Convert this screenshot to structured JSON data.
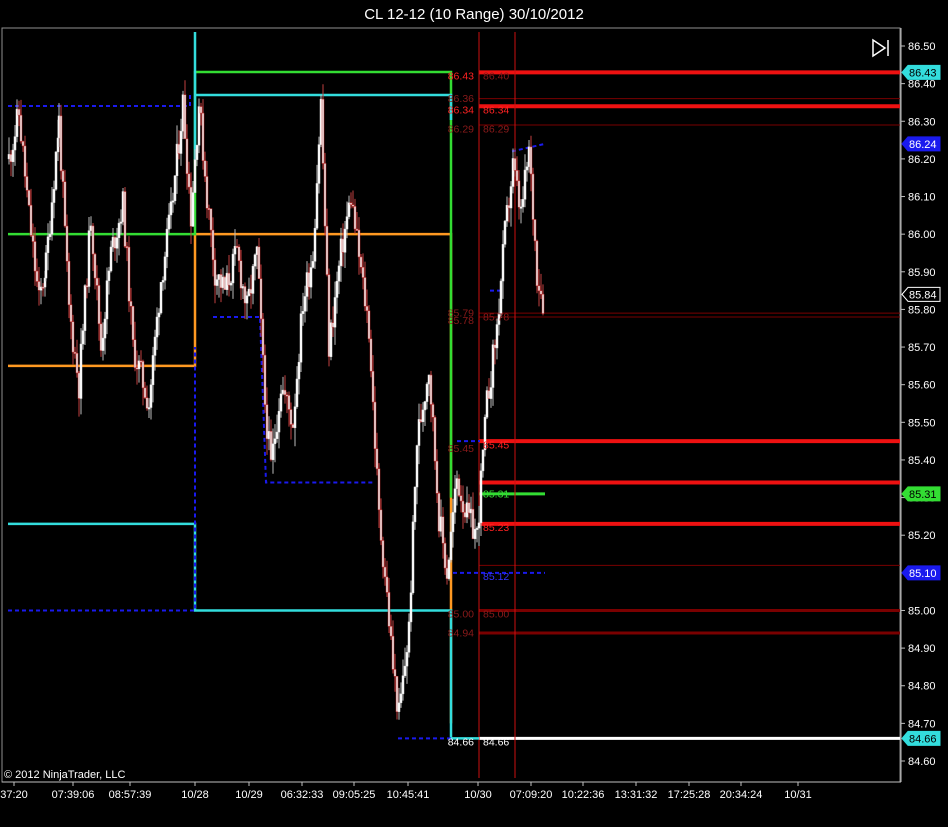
{
  "window": {
    "title": "CL 12-12 (10 Range)  30/10/2012"
  },
  "copyright": "© 2012 NinjaTrader, LLC",
  "colors": {
    "background": "#000000",
    "axis": "#c0c0c0",
    "green": "#33dd33",
    "cyan": "#33dddd",
    "orange": "#ff9922",
    "red": "#ee1111",
    "dark_red": "#7a0000",
    "blue_dashed": "#1a1aee",
    "white": "#ffffff"
  },
  "icons": {
    "scroll_end": "play-to-end-icon"
  },
  "chart_data": {
    "type": "candlestick",
    "y_axis": {
      "min": 84.56,
      "max": 86.54,
      "ticks": [
        "86.50",
        "86.40",
        "86.30",
        "86.20",
        "86.10",
        "86.00",
        "85.90",
        "85.80",
        "85.70",
        "85.60",
        "85.50",
        "85.40",
        "85.30",
        "85.20",
        "85.10",
        "85.00",
        "84.90",
        "84.80",
        "84.70",
        "84.60"
      ]
    },
    "x_axis": {
      "ticks": [
        "37:20",
        "07:39:06",
        "08:57:39",
        "10/28",
        "10/29",
        "06:32:33",
        "09:05:25",
        "10:45:41",
        "10/30",
        "07:09:20",
        "10:22:36",
        "13:31:32",
        "17:25:28",
        "20:34:24",
        "10/31"
      ]
    },
    "price_markers": [
      {
        "label": "86.43",
        "value": 86.43,
        "style": "cyan"
      },
      {
        "label": "86.24",
        "value": 86.24,
        "style": "blue"
      },
      {
        "label": "85.84",
        "value": 85.84,
        "style": "dark"
      },
      {
        "label": "85.31",
        "value": 85.31,
        "style": "green"
      },
      {
        "label": "85.10",
        "value": 85.1,
        "style": "blue"
      },
      {
        "label": "84.66",
        "value": 84.66,
        "style": "cyan"
      }
    ],
    "level_labels_right": [
      {
        "label": "86.40",
        "value": 86.42,
        "style": "dark"
      },
      {
        "label": "86.34",
        "value": 86.33,
        "style": "red"
      },
      {
        "label": "86.29",
        "value": 86.28,
        "style": "dark"
      },
      {
        "label": "85.78",
        "value": 85.78,
        "style": "dark"
      },
      {
        "label": "85.45",
        "value": 85.44,
        "style": "red"
      },
      {
        "label": "85.31",
        "value": 85.31,
        "style": "green"
      },
      {
        "label": "85.23",
        "value": 85.22,
        "style": "red"
      },
      {
        "label": "85.12",
        "value": 85.09,
        "style": "blue"
      },
      {
        "label": "85.00",
        "value": 84.99,
        "style": "dark"
      },
      {
        "label": "84.66",
        "value": 84.65,
        "style": "white"
      }
    ],
    "level_labels_left": [
      {
        "label": "86.43",
        "value": 86.42,
        "style": "red"
      },
      {
        "label": "86.36",
        "value": 86.36,
        "style": "dark"
      },
      {
        "label": "86.34",
        "value": 86.33,
        "style": "red"
      },
      {
        "label": "86.29",
        "value": 86.28,
        "style": "dark"
      },
      {
        "label": "85.79",
        "value": 85.79,
        "style": "dark"
      },
      {
        "label": "85.78",
        "value": 85.77,
        "style": "dark"
      },
      {
        "label": "85.45",
        "value": 85.43,
        "style": "dark"
      },
      {
        "label": "85.00",
        "value": 84.99,
        "style": "dark"
      },
      {
        "label": "84.94",
        "value": 84.94,
        "style": "dark"
      },
      {
        "label": "84.66",
        "value": 84.65,
        "style": "white"
      }
    ],
    "right_levels": [
      {
        "value": 86.43,
        "style": "red_thick"
      },
      {
        "value": 86.36,
        "style": "dark_thin"
      },
      {
        "value": 86.34,
        "style": "red_thick"
      },
      {
        "value": 86.29,
        "style": "dark_thin"
      },
      {
        "value": 85.79,
        "style": "dark_thin"
      },
      {
        "value": 85.78,
        "style": "dark_thin"
      },
      {
        "value": 85.45,
        "style": "red_thick"
      },
      {
        "value": 85.34,
        "style": "red_thick"
      },
      {
        "value": 85.23,
        "style": "red_thick"
      },
      {
        "value": 85.12,
        "style": "dark_thin"
      },
      {
        "value": 85.0,
        "style": "dark_thick"
      },
      {
        "value": 84.94,
        "style": "dark_thick"
      },
      {
        "value": 84.66,
        "style": "white_thick"
      }
    ]
  }
}
